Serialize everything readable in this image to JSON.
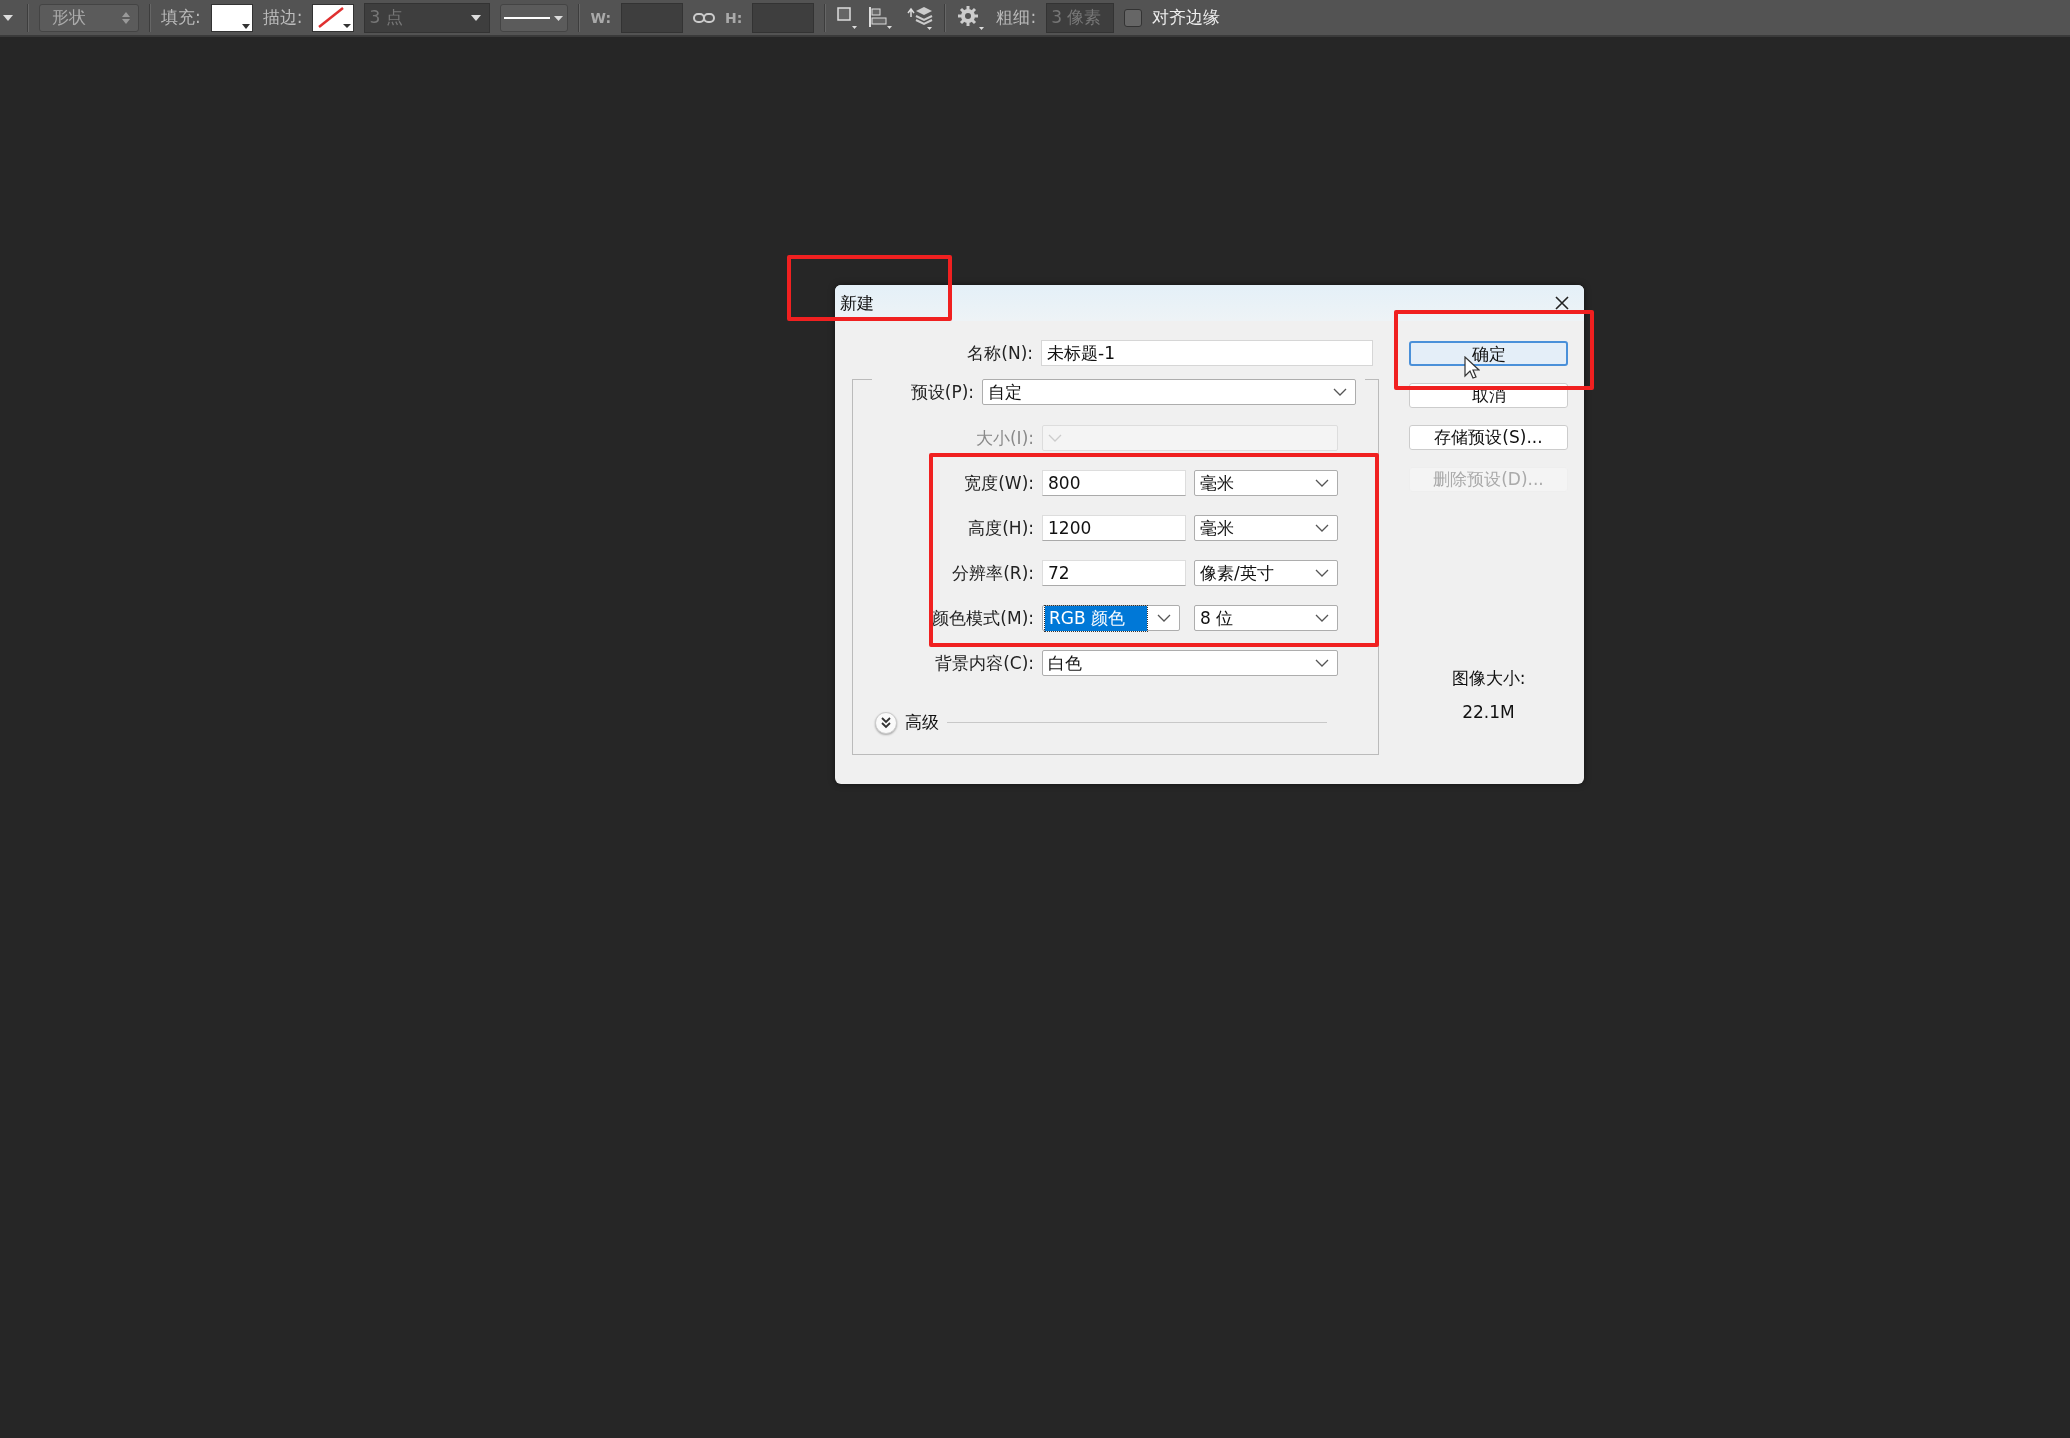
{
  "toolbar": {
    "shape_mode": "形状",
    "fill_label": "填充:",
    "stroke_label": "描边:",
    "stroke_width": "3 点",
    "w_label": "W:",
    "h_label": "H:",
    "weight_label": "粗细:",
    "weight_value": "3 像素",
    "align_edges": {
      "label": "对齐边缘",
      "checked": false
    }
  },
  "dialog": {
    "title": "新建",
    "name": {
      "label": "名称(N):",
      "value": "未标题-1"
    },
    "preset": {
      "label": "预设(P):",
      "value": "自定"
    },
    "rows": [
      {
        "kind": "select",
        "label": "大小(I):",
        "disabled": true
      },
      {
        "kind": "number",
        "label": "宽度(W):",
        "value": "800",
        "unit": "毫米"
      },
      {
        "kind": "number",
        "label": "高度(H):",
        "value": "1200",
        "unit": "毫米"
      },
      {
        "kind": "number",
        "label": "分辨率(R):",
        "value": "72",
        "unit": "像素/英寸"
      },
      {
        "kind": "select_pair",
        "label": "颜色模式(M):",
        "value": "RGB 颜色",
        "unit": "8 位",
        "focused": true
      },
      {
        "kind": "select",
        "label": "背景内容(C):",
        "value": "白色",
        "disabled": false
      }
    ],
    "advanced": {
      "label": "高级",
      "expanded": false
    },
    "buttons": [
      {
        "label": "确定",
        "default": true,
        "disabled": false
      },
      {
        "label": "取消",
        "default": false,
        "disabled": false
      },
      {
        "label": "存储预设(S)...",
        "default": false,
        "disabled": false
      },
      {
        "label": "删除预设(D)...",
        "default": false,
        "disabled": true
      }
    ],
    "image_size": {
      "label": "图像大小:",
      "value": "22.1M"
    }
  }
}
